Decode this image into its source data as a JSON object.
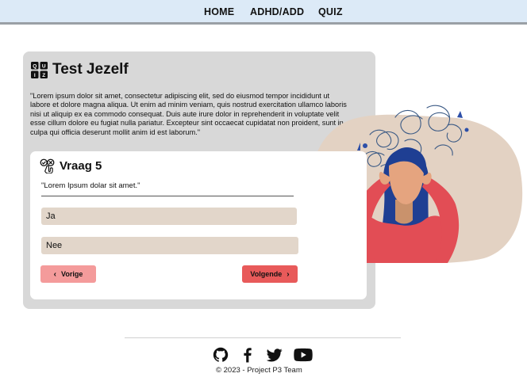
{
  "nav": {
    "items": [
      {
        "label": "HOME"
      },
      {
        "label": "ADHD/ADD"
      },
      {
        "label": "QUIZ"
      }
    ]
  },
  "card": {
    "title": "Test Jezelf",
    "intro": "\"Lorem ipsum dolor sit amet, consectetur adipiscing elit, sed do eiusmod tempor incididunt ut labore et dolore magna aliqua. Ut enim ad minim veniam, quis nostrud exercitation ullamco laboris nisi ut aliquip ex ea commodo consequat. Duis aute irure dolor in reprehenderit in voluptate velit esse cillum dolore eu fugiat nulla pariatur. Excepteur sint occaecat cupidatat non proident, sunt in culpa qui officia deserunt mollit anim id est laborum.\""
  },
  "question": {
    "title": "Vraag 5",
    "text": "\"Lorem Ipsum dolar sit amet.\"",
    "options": [
      {
        "label": "Ja"
      },
      {
        "label": "Nee"
      }
    ],
    "prev_label": "Vorige",
    "next_label": "Volgende"
  },
  "footer": {
    "copyright": "© 2023 - Project P3 Team",
    "socials": [
      "github-icon",
      "facebook-icon",
      "twitter-icon",
      "youtube-icon"
    ]
  },
  "colors": {
    "nav_bg": "#dceaf7",
    "card_bg": "#d8d8d8",
    "option_bg": "#e2d6ca",
    "prev_btn": "#f49b9b",
    "next_btn": "#e85a5a"
  }
}
